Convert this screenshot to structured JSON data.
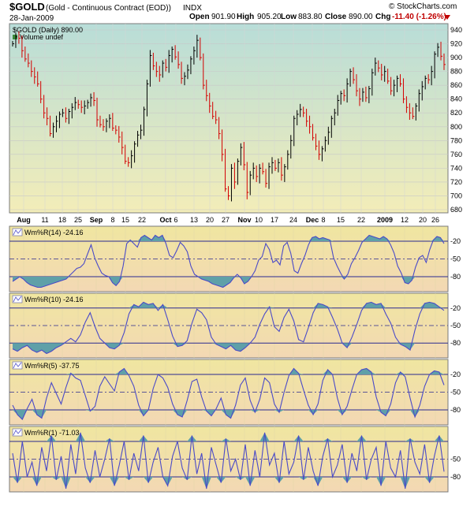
{
  "header": {
    "symbol": "$GOLD",
    "description": "(Gold - Continuous Contract (EOD))",
    "exchange": "INDX",
    "date": "28-Jan-2009",
    "open_label": "Open",
    "open": "901.90",
    "high_label": "High",
    "high": "905.20",
    "low_label": "Low",
    "low": "883.80",
    "close_label": "Close",
    "close": "890.00",
    "chg_label": "Chg",
    "chg": "-11.40 (-1.26%)",
    "watermark": "© StockCharts.com"
  },
  "colors": {
    "up": "#000000",
    "down": "#d40000",
    "indicator": "#4a4ac8",
    "fill": "#5fa0a8",
    "price_bg_top": "#b8ddd8",
    "price_bg_bottom": "#f3edb8",
    "osc_bg_top": "#f0e6a0",
    "osc_bg_bottom": "#f3d8b4"
  },
  "x_axis_labels": [
    "Aug",
    "11",
    "18",
    "25",
    "Sep",
    "8",
    "15",
    "22",
    "Oct",
    "6",
    "13",
    "20",
    "27",
    "Nov",
    "10",
    "17",
    "24",
    "Dec",
    "8",
    "15",
    "22",
    "2009",
    "12",
    "20",
    "26"
  ],
  "chart_data": [
    {
      "type": "ohlc",
      "title": "$GOLD (Daily) 890.00",
      "legend": [
        "Volume undef"
      ],
      "ylim": [
        680,
        940
      ],
      "yticks": [
        680,
        700,
        720,
        740,
        760,
        780,
        800,
        820,
        840,
        860,
        880,
        900,
        920,
        940
      ],
      "series": [
        {
          "name": "$GOLD (Daily)",
          "close": [
            920,
            930,
            928,
            910,
            898,
            892,
            880,
            872,
            862,
            840,
            820,
            812,
            790,
            800,
            808,
            818,
            820,
            812,
            822,
            828,
            835,
            832,
            828,
            830,
            835,
            842,
            838,
            810,
            803,
            800,
            808,
            812,
            798,
            795,
            785,
            770,
            750,
            748,
            758,
            775,
            788,
            795,
            825,
            862,
            903,
            888,
            880,
            875,
            892,
            886,
            903,
            912,
            901,
            890,
            870,
            873,
            882,
            898,
            910,
            925,
            900,
            860,
            845,
            830,
            815,
            810,
            790,
            760,
            710,
            700,
            740,
            720,
            750,
            770,
            745,
            705,
            730,
            740,
            728,
            740,
            735,
            718,
            742,
            748,
            740,
            748,
            730,
            742,
            760,
            780,
            812,
            818,
            825,
            820,
            808,
            800,
            784,
            772,
            760,
            768,
            780,
            792,
            812,
            820,
            838,
            848,
            845,
            862,
            880,
            868,
            852,
            840,
            850,
            842,
            855,
            878,
            892,
            885,
            875,
            880,
            866,
            852,
            860,
            870,
            862,
            840,
            828,
            820,
            815,
            830,
            848,
            858,
            870,
            868,
            880,
            905,
            915,
            902,
            890
          ]
        }
      ],
      "xlabel": "",
      "ylabel": ""
    },
    {
      "type": "line",
      "title": "Wm%R(14) -24.16",
      "yticks": [
        -20,
        -50,
        -80
      ],
      "ylim": [
        -100,
        0
      ],
      "series": [
        {
          "name": "Wm%R(14)",
          "values": [
            -88,
            -84,
            -80,
            -84,
            -90,
            -94,
            -96,
            -98,
            -98,
            -96,
            -94,
            -92,
            -90,
            -88,
            -86,
            -84,
            -78,
            -72,
            -66,
            -64,
            -58,
            -42,
            -26,
            -48,
            -62,
            -74,
            -78,
            -80,
            -90,
            -95,
            -88,
            -62,
            -24,
            -18,
            -24,
            -30,
            -14,
            -10,
            -14,
            -18,
            -10,
            -14,
            -10,
            -24,
            -44,
            -48,
            -36,
            -22,
            -28,
            -38,
            -62,
            -76,
            -80,
            -84,
            -86,
            -88,
            -92,
            -94,
            -96,
            -98,
            -94,
            -90,
            -82,
            -76,
            -82,
            -92,
            -88,
            -80,
            -70,
            -52,
            -46,
            -24,
            -34,
            -56,
            -52,
            -60,
            -28,
            -22,
            -40,
            -70,
            -74,
            -58,
            -44,
            -26,
            -14,
            -12,
            -16,
            -14,
            -16,
            -18,
            -48,
            -62,
            -74,
            -84,
            -76,
            -58,
            -48,
            -36,
            -22,
            -16,
            -10,
            -12,
            -14,
            -16,
            -12,
            -16,
            -26,
            -40,
            -62,
            -74,
            -90,
            -92,
            -86,
            -64,
            -48,
            -44,
            -56,
            -34,
            -18,
            -12,
            -14,
            -24
          ]
        }
      ]
    },
    {
      "type": "line",
      "title": "Wm%R(10) -24.16",
      "yticks": [
        -20,
        -50,
        -80
      ],
      "ylim": [
        -100,
        0
      ],
      "series": [
        {
          "name": "Wm%R(10)",
          "values": [
            -90,
            -94,
            -88,
            -84,
            -92,
            -96,
            -92,
            -98,
            -94,
            -88,
            -84,
            -78,
            -72,
            -78,
            -66,
            -44,
            -28,
            -52,
            -72,
            -80,
            -88,
            -90,
            -84,
            -62,
            -30,
            -14,
            -18,
            -10,
            -14,
            -12,
            -24,
            -14,
            -40,
            -68,
            -86,
            -84,
            -76,
            -46,
            -22,
            -28,
            -40,
            -70,
            -82,
            -86,
            -90,
            -84,
            -92,
            -94,
            -88,
            -80,
            -70,
            -48,
            -30,
            -18,
            -52,
            -60,
            -36,
            -22,
            -42,
            -74,
            -78,
            -54,
            -28,
            -12,
            -14,
            -18,
            -36,
            -56,
            -80,
            -88,
            -70,
            -48,
            -24,
            -12,
            -10,
            -14,
            -12,
            -30,
            -46,
            -70,
            -82,
            -86,
            -92,
            -58,
            -30,
            -12,
            -10,
            -12,
            -18,
            -24
          ]
        }
      ]
    },
    {
      "type": "line",
      "title": "Wm%R(5) -37.75",
      "yticks": [
        -20,
        -50,
        -80
      ],
      "ylim": [
        -100,
        0
      ],
      "series": [
        {
          "name": "Wm%R(5)",
          "values": [
            -72,
            -88,
            -96,
            -78,
            -62,
            -88,
            -94,
            -60,
            -34,
            -52,
            -70,
            -42,
            -18,
            -26,
            -30,
            -56,
            -82,
            -74,
            -40,
            -24,
            -36,
            -48,
            -16,
            -10,
            -22,
            -40,
            -72,
            -90,
            -80,
            -44,
            -20,
            -26,
            -42,
            -70,
            -88,
            -92,
            -64,
            -32,
            -28,
            -58,
            -82,
            -90,
            -78,
            -60,
            -88,
            -94,
            -72,
            -38,
            -26,
            -64,
            -84,
            -62,
            -26,
            -34,
            -70,
            -84,
            -50,
            -22,
            -10,
            -18,
            -46,
            -72,
            -88,
            -70,
            -30,
            -12,
            -20,
            -60,
            -88,
            -74,
            -46,
            -20,
            -12,
            -10,
            -16,
            -58,
            -84,
            -90,
            -70,
            -34,
            -16,
            -24,
            -60,
            -92,
            -72,
            -40,
            -20,
            -14,
            -16,
            -38
          ]
        }
      ]
    },
    {
      "type": "line",
      "title": "Wm%R(1) -71.03",
      "yticks": [
        -50,
        -80
      ],
      "ylim": [
        -100,
        0
      ],
      "series": [
        {
          "name": "Wm%R(1)",
          "values": [
            -40,
            -90,
            -20,
            -80,
            -55,
            -95,
            -30,
            -70,
            -10,
            -85,
            -45,
            -100,
            -25,
            -75,
            -5,
            -65,
            -90,
            -35,
            -80,
            -50,
            -15,
            -95,
            -60,
            -20,
            -85,
            -40,
            -70,
            -10,
            -90,
            -55,
            -30,
            -80,
            -95,
            -45,
            -20,
            -65,
            -85,
            -10,
            -75,
            -40,
            -100,
            -30,
            -60,
            -90,
            -15,
            -70,
            -50,
            -85,
            -25,
            -95,
            -35,
            -80,
            -5,
            -60,
            -40,
            -90,
            -20,
            -75,
            -55,
            -10,
            -85,
            -30,
            -70,
            -95,
            -45,
            -15,
            -80,
            -60,
            -25,
            -90,
            -40,
            -70,
            -10,
            -85,
            -50,
            -30,
            -95,
            -20,
            -65,
            -80,
            -35,
            -100,
            -15,
            -55,
            -75,
            -25,
            -90,
            -45,
            -10,
            -71
          ]
        }
      ]
    }
  ]
}
